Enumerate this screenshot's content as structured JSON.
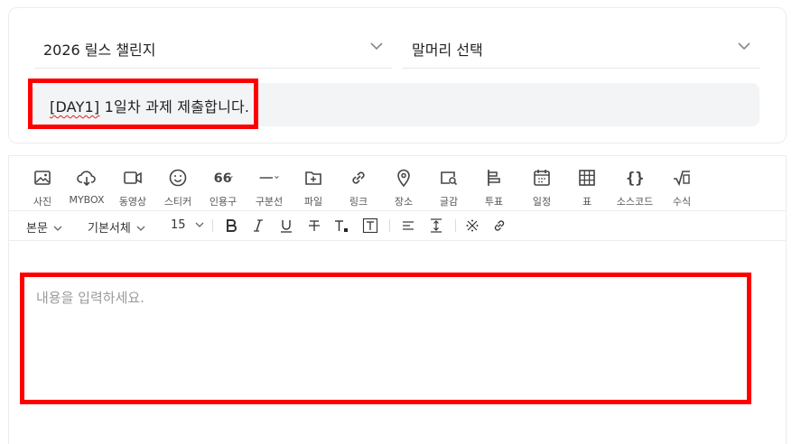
{
  "header": {
    "challenge_select": "2026 릴스 챌린지",
    "prefix_select": "말머리 선택",
    "post_title_prefix": "[DAY1]",
    "post_title_rest": " 1일차 과제 제출합니다."
  },
  "toolbar": {
    "items": [
      {
        "icon": "photo-icon",
        "label": "사진"
      },
      {
        "icon": "cloud-icon",
        "label": "MYBOX"
      },
      {
        "icon": "video-icon",
        "label": "동영상"
      },
      {
        "icon": "smiley-icon",
        "label": "스티커"
      },
      {
        "icon": "quote-icon",
        "label": "인용구"
      },
      {
        "icon": "divider-icon",
        "label": "구분선"
      },
      {
        "icon": "file-icon",
        "label": "파일"
      },
      {
        "icon": "link-icon",
        "label": "링크"
      },
      {
        "icon": "location-icon",
        "label": "장소"
      },
      {
        "icon": "search-post-icon",
        "label": "글감"
      },
      {
        "icon": "vote-icon",
        "label": "투표"
      },
      {
        "icon": "calendar-icon",
        "label": "일정"
      },
      {
        "icon": "table-icon",
        "label": "표"
      },
      {
        "icon": "code-icon",
        "label": "소스코드"
      },
      {
        "icon": "formula-icon",
        "label": "수식"
      }
    ]
  },
  "format": {
    "paragraph_style": "본문",
    "font_family": "기본서체",
    "font_size": "15"
  },
  "editor": {
    "placeholder": "내용을 입력하세요."
  },
  "colors": {
    "highlight": "#ff0000",
    "title_bg": "#f3f4f6"
  }
}
